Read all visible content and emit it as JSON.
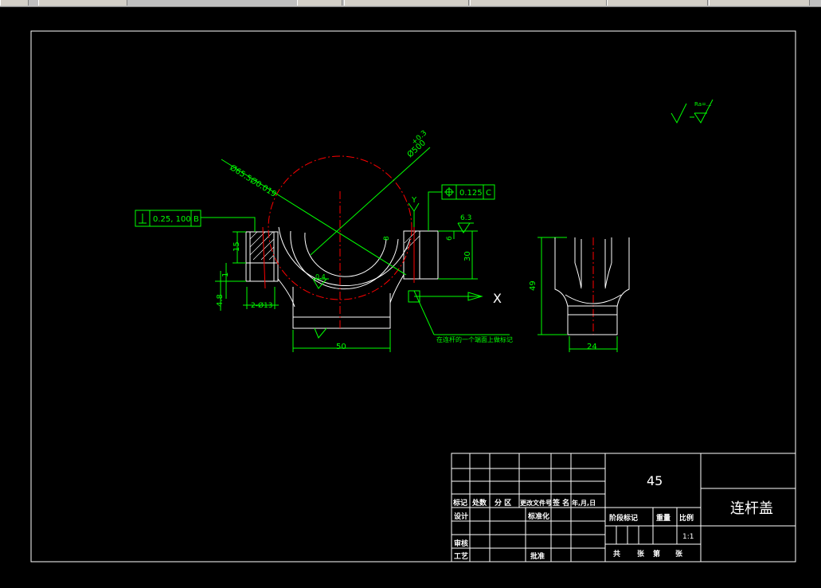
{
  "colors": {
    "background": "#000000",
    "border": "#ffffff",
    "geometry": "#ffffff",
    "dimension": "#00ff00",
    "centerline": "#ff0000"
  },
  "icons": {
    "surface_finish": "roughness-symbol-icon",
    "datum_marker": "datum-triangle-icon",
    "position_tolerance": "position-tolerance-icon",
    "perpendicularity": "perpendicularity-icon",
    "coordinate_x": "x-axis-icon",
    "coordinate_y": "y-axis-icon"
  },
  "drawing": {
    "annotations": {
      "dim_bore": "Ø65.5Ø0.019",
      "dim_bore_tol": "+0.3",
      "dim_arc": "Ø500",
      "gdt_perp_value": "0.25, 100",
      "gdt_perp_datum": "B",
      "gdt_pos_value": "0.125",
      "gdt_pos_datum": "C",
      "dim_15": "15",
      "dim_1": "1",
      "dim_4_8": "4.8",
      "dim_holes": "2-Ø13",
      "dim_50": "50",
      "dim_6": "6",
      "dim_30": "30",
      "dim_8": "8",
      "dim_6_3": "6.3",
      "dim_0_4": "0.4",
      "dim_49": "49",
      "dim_24": "24",
      "leader_note": "在连杆的一个端面上做标记",
      "axis_x": "X",
      "axis_y": "Y",
      "finish_note": "Ra=..."
    }
  },
  "title_block": {
    "material": "45",
    "part_name": "连杆盖",
    "scale_value": "1:1",
    "rev_headers": [
      "标记",
      "处数",
      "分 区",
      "更改文件号",
      "签 名",
      "年,月,日"
    ],
    "design": "设计",
    "standardize": "标准化",
    "review": "审核",
    "process": "工艺",
    "approve": "批准",
    "stage_mark": "阶段标记",
    "weight": "重量",
    "scale": "比例",
    "total_sheets": "共",
    "sheet_unit": "张",
    "sheet_num": "第",
    "sheet_unit2": "张"
  }
}
